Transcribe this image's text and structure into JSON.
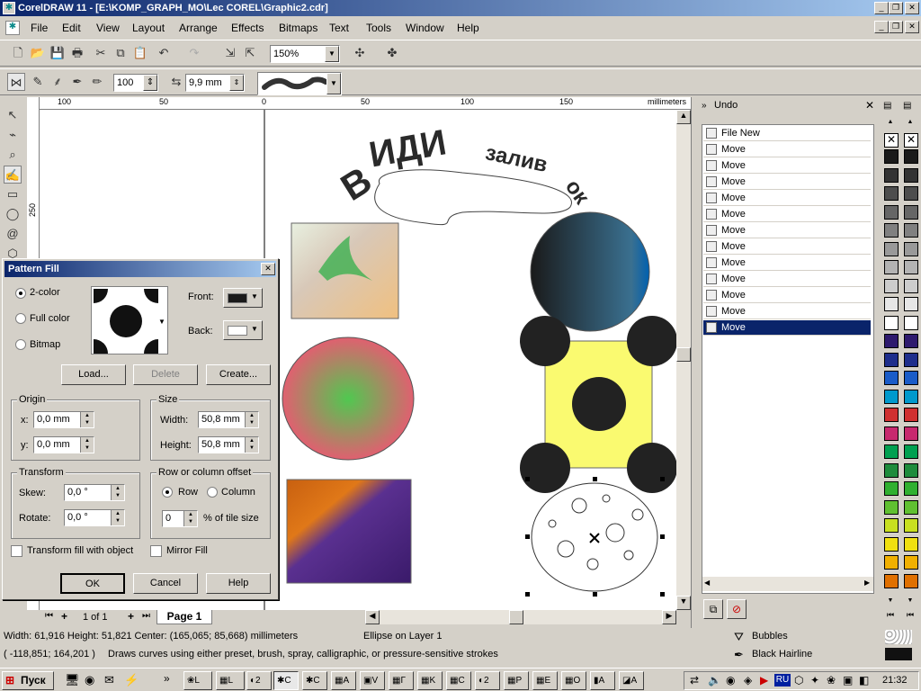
{
  "window": {
    "title": "CorelDRAW 11 - [E:\\KOMP_GRAPH_MO\\Lec COREL\\Graphic2.cdr]"
  },
  "menu": [
    "File",
    "Edit",
    "View",
    "Layout",
    "Arrange",
    "Effects",
    "Bitmaps",
    "Text",
    "Tools",
    "Window",
    "Help"
  ],
  "toolbar": {
    "zoom": "150%"
  },
  "property_bar": {
    "smoothness": "100",
    "width": "9,9 mm"
  },
  "ruler": {
    "units": "millimeters",
    "ticks": [
      "100",
      "50",
      "0",
      "50",
      "100",
      "150"
    ],
    "vtick": "250"
  },
  "canvas": {
    "arc_text": "ВИДИ заливок"
  },
  "dialog": {
    "title": "Pattern Fill",
    "options": [
      "2-color",
      "Full color",
      "Bitmap"
    ],
    "front_label": "Front:",
    "back_label": "Back:",
    "load": "Load...",
    "delete": "Delete",
    "create": "Create...",
    "origin": {
      "title": "Origin",
      "x_label": "x:",
      "x": "0,0 mm",
      "y_label": "y:",
      "y": "0,0 mm"
    },
    "size": {
      "title": "Size",
      "w_label": "Width:",
      "w": "50,8 mm",
      "h_label": "Height:",
      "h": "50,8 mm"
    },
    "transform": {
      "title": "Transform",
      "skew_label": "Skew:",
      "skew": "0,0 °",
      "rotate_label": "Rotate:",
      "rotate": "0,0 °"
    },
    "offset": {
      "title": "Row or column offset",
      "row": "Row",
      "column": "Column",
      "value": "0",
      "unit": "% of tile size"
    },
    "transform_fill": "Transform fill with object",
    "mirror": "Mirror Fill",
    "ok": "OK",
    "cancel": "Cancel",
    "help": "Help"
  },
  "page_tabs": {
    "counter": "1 of 1",
    "page": "Page 1"
  },
  "undo": {
    "title": "Undo",
    "items": [
      "File New",
      "Move",
      "Move",
      "Move",
      "Move",
      "Move",
      "Move",
      "Move",
      "Move",
      "Move",
      "Move",
      "Move",
      "Move"
    ]
  },
  "status": {
    "dims": "Width: 61,916  Height: 51,821  Center: (165,065; 85,668)  millimeters",
    "object": "Ellipse on Layer 1",
    "coords": "( -118,851; 164,201 )",
    "hint": "Draws curves using either preset, brush, spray, calligraphic, or pressure-sensitive strokes",
    "fill": "Bubbles",
    "outline": "Black  Hairline"
  },
  "taskbar": {
    "start": "Пуск",
    "clock": "21:32",
    "lang": "RU"
  },
  "palette": [
    "#1a1a1a",
    "#333333",
    "#4d4d4d",
    "#666666",
    "#808080",
    "#999999",
    "#b3b3b3",
    "#cccccc",
    "#e6e6e6",
    "#ffffff",
    "#2e1a6e",
    "#1e2e8c",
    "#1a5cc8",
    "#0099cc",
    "#d03030",
    "#c8286e",
    "#00a050",
    "#1e8c3c",
    "#30b030",
    "#60c030",
    "#c8e020",
    "#f0e010",
    "#f0b000",
    "#e07000"
  ]
}
